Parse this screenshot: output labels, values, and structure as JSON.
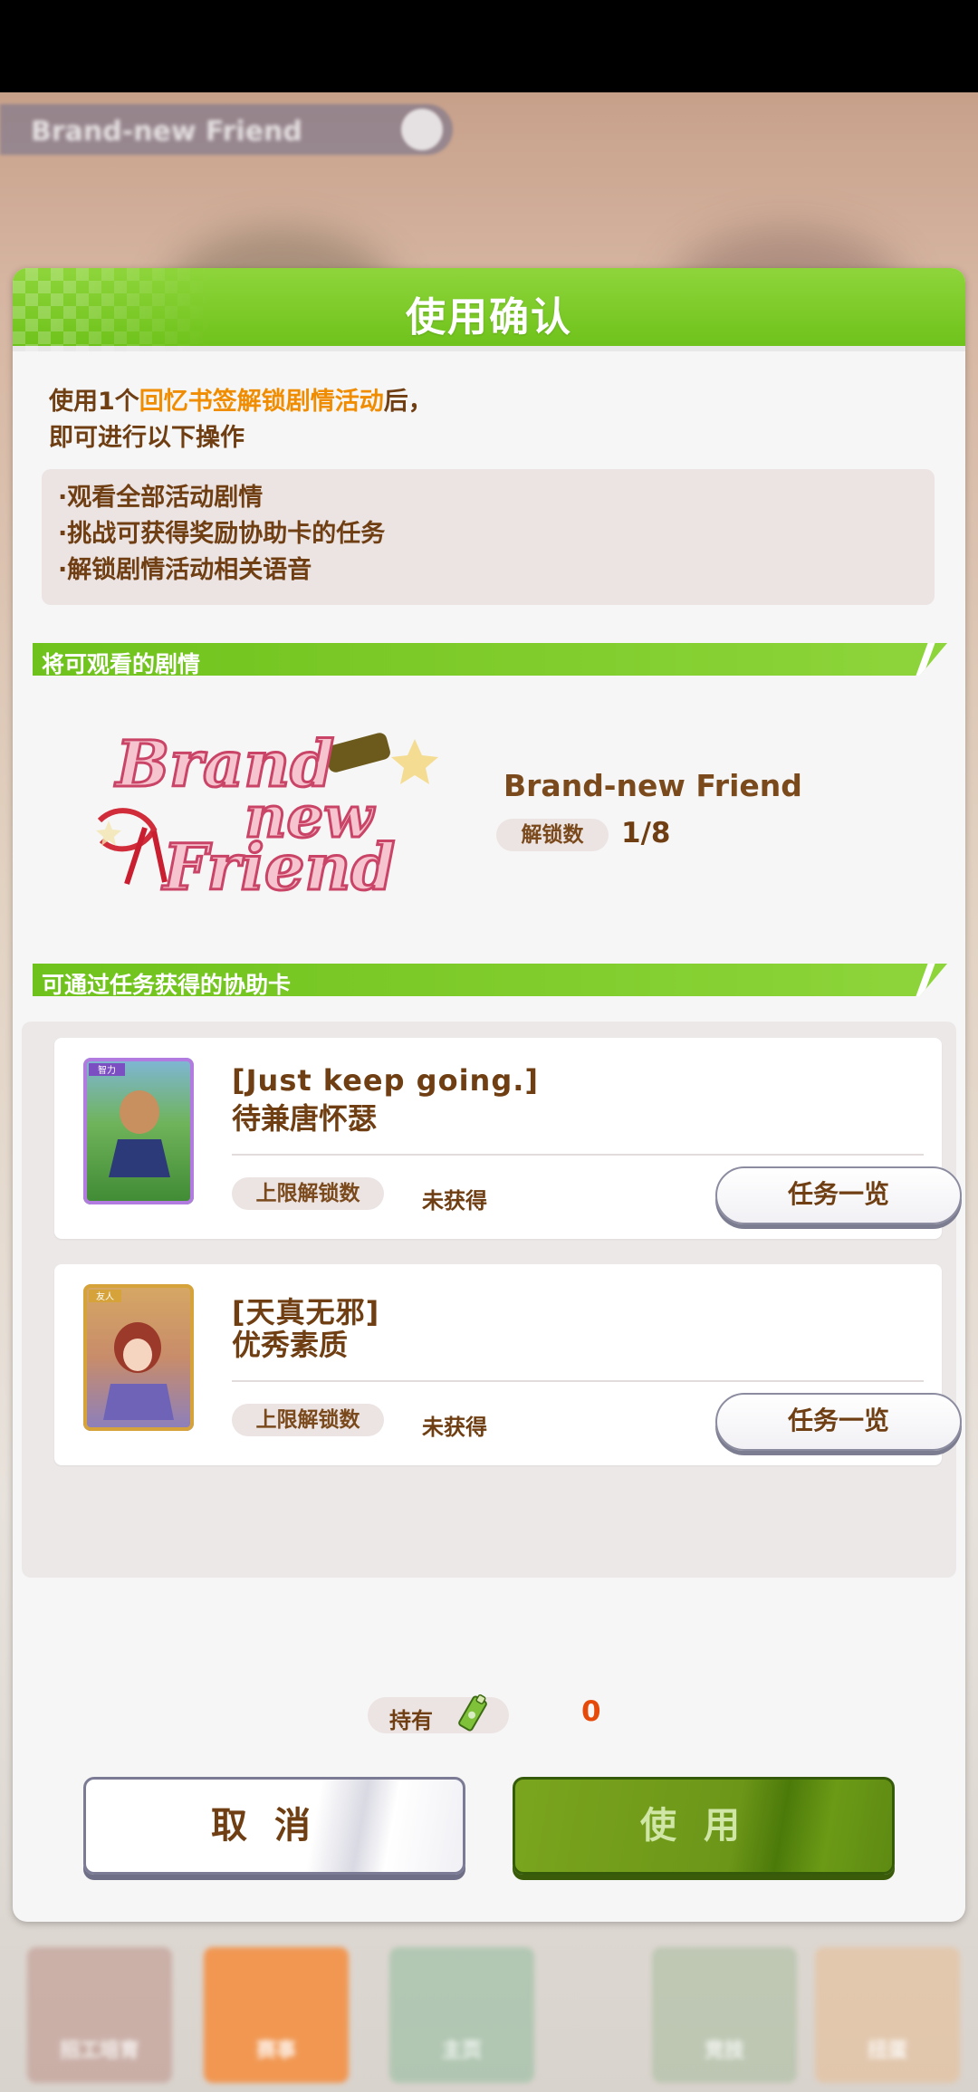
{
  "background": {
    "title_pill_text": "Brand-new Friend",
    "nav_labels": [
      "招工培育",
      "赛事",
      "主页",
      "竞技",
      "扭蛋"
    ]
  },
  "dialog": {
    "title": "使用确认",
    "intro": {
      "prefix": "使用1个",
      "highlight": "回忆书签解锁剧情活动",
      "suffix": "后，",
      "line2": "即可进行以下操作"
    },
    "benefits": [
      "·观看全部活动剧情",
      "·挑战可获得奖励协助卡的任务",
      "·解锁剧情活动相关语音"
    ],
    "story_section": {
      "label": "将可观看的剧情",
      "logo_text": [
        "Brand",
        "new",
        "Friend"
      ],
      "story_name": "Brand-new Friend",
      "unlock_label": "解锁数",
      "unlock_value": "1/8"
    },
    "cards_section": {
      "label": "可通过任务获得的协助卡",
      "cards": [
        {
          "title": "[Just keep going.]",
          "subtitle": "待兼唐怀瑟",
          "limit_label": "上限解锁数",
          "status": "未获得",
          "button": "任务一览",
          "rarity_tag": "智力"
        },
        {
          "title": "[天真无邪]",
          "subtitle": "优秀素质",
          "limit_label": "上限解锁数",
          "status": "未获得",
          "button": "任务一览",
          "rarity_tag": "友人"
        }
      ]
    },
    "hold": {
      "label": "持有",
      "icon": "bookmark-item-icon",
      "count": "0"
    },
    "buttons": {
      "cancel": "取消",
      "use": "使用"
    }
  },
  "colors": {
    "header_green": "#8ed53b",
    "highlight_orange": "#f08c00",
    "count_red": "#e64a0a",
    "text_brown": "#6f3f13"
  }
}
